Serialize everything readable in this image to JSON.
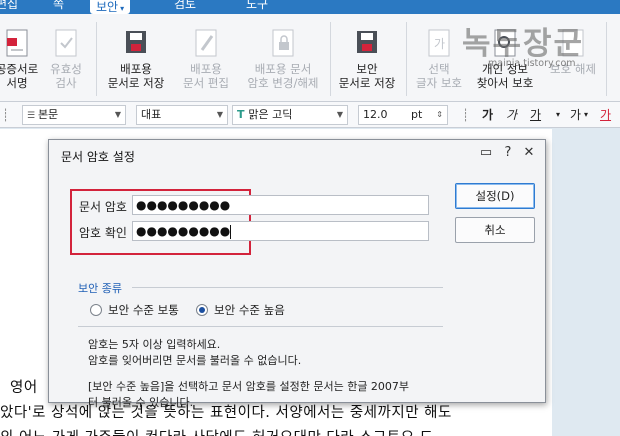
{
  "menu": {
    "items": [
      "편집",
      "쪽",
      "보안",
      "검토",
      "도구"
    ],
    "active_index": 2
  },
  "ribbon": {
    "buttons": [
      {
        "line1": "공증서로",
        "line2": "서명",
        "disabled": false,
        "icon": "certificate-sign-icon"
      },
      {
        "line1": "유효성",
        "line2": "검사",
        "disabled": true,
        "icon": "validate-icon"
      },
      {
        "line1": "배포용",
        "line2": "문서로 저장",
        "disabled": false,
        "icon": "distribute-save-icon"
      },
      {
        "line1": "배포용",
        "line2": "문서 편집",
        "disabled": true,
        "icon": "distribute-edit-icon"
      },
      {
        "line1": "배포용 문서",
        "line2": "암호 변경/해제",
        "disabled": true,
        "icon": "distribute-password-icon"
      },
      {
        "line1": "보안",
        "line2": "문서로 저장",
        "disabled": false,
        "icon": "secure-save-icon"
      },
      {
        "line1": "선택",
        "line2": "글자 보호",
        "disabled": true,
        "icon": "protect-text-icon"
      },
      {
        "line1": "개인 정보",
        "line2": "찾아서 보호",
        "disabled": false,
        "icon": "find-protect-icon"
      },
      {
        "line1": "",
        "line2": "보호 해제",
        "disabled": true,
        "icon": "unprotect-icon"
      }
    ]
  },
  "formatbar": {
    "style": "본문",
    "lang": "대표",
    "font": "맑은 고딕",
    "size": "12.0",
    "unit": "pt"
  },
  "watermark": {
    "text": "녹두장군",
    "url": "mainia.tistory.com"
  },
  "document": {
    "line1": "영어",
    "line2": "았다'로 상석에 앉는 것을 뜻하는 표현이다. 서양에서는 중세까지만 해도",
    "line3": "의 어느 가게 가주들이 컨다라 사당에도 허거요대만 다라 소그토오 드"
  },
  "dialog": {
    "title": "문서 암호 설정",
    "password_label": "문서 암호",
    "password_value": "●●●●●●●●●",
    "confirm_label": "암호 확인",
    "confirm_value": "●●●●●●●●●",
    "security_legend": "보안 종류",
    "radio_normal": "보안 수준 보통",
    "radio_high": "보안 수준 높음",
    "selected": "high",
    "info1": "암호는 5자 이상 입력하세요.",
    "info2": "암호를 잊어버리면 문서를 불러올 수 없습니다.",
    "info3": "[보안 수준 높음]을 선택하고 문서 암호를 설정한 문서는 한글 2007부",
    "info4": "터 불러올 수 있습니다.",
    "ok_label": "설정(D)",
    "cancel_label": "취소"
  },
  "colors": {
    "menubar": "#2b79c2",
    "highlight": "#d3233b",
    "accent": "#1f5fb5"
  }
}
